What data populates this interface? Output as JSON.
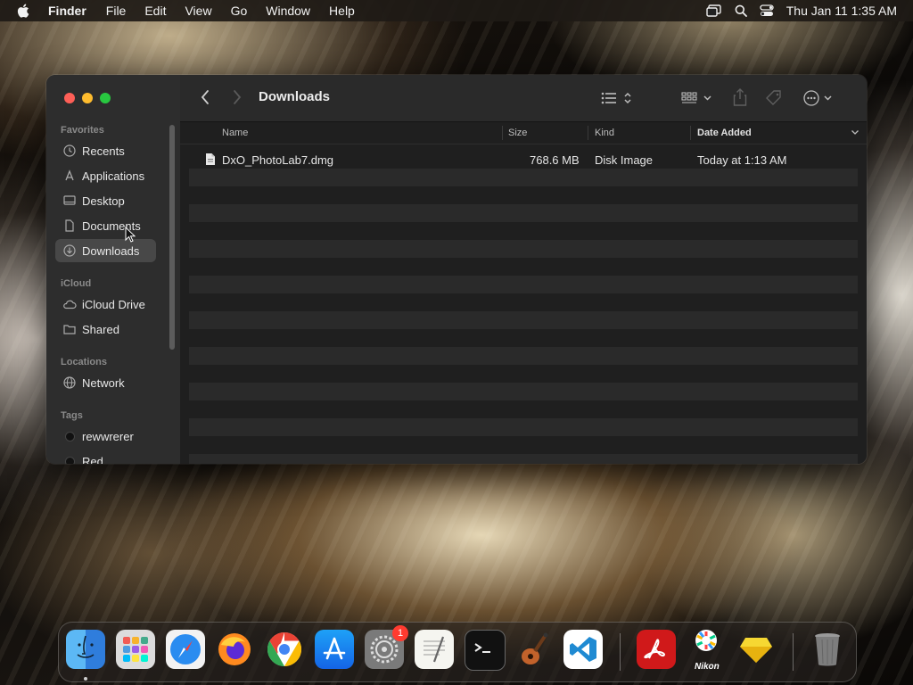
{
  "menubar": {
    "app_name": "Finder",
    "items": [
      "File",
      "Edit",
      "View",
      "Go",
      "Window",
      "Help"
    ],
    "clock": "Thu Jan 11  1:35 AM",
    "status_icons": [
      "screen-mirroring-icon",
      "spotlight-search-icon",
      "control-center-icon"
    ]
  },
  "window": {
    "title": "Downloads",
    "sidebar": {
      "favorites_header": "Favorites",
      "favorites": [
        {
          "label": "Recents",
          "icon": "clock-icon"
        },
        {
          "label": "Applications",
          "icon": "applications-icon"
        },
        {
          "label": "Desktop",
          "icon": "desktop-icon"
        },
        {
          "label": "Documents",
          "icon": "document-icon"
        },
        {
          "label": "Downloads",
          "icon": "download-icon",
          "selected": true
        }
      ],
      "icloud_header": "iCloud",
      "icloud": [
        {
          "label": "iCloud Drive",
          "icon": "cloud-icon"
        },
        {
          "label": "Shared",
          "icon": "shared-folder-icon"
        }
      ],
      "locations_header": "Locations",
      "locations": [
        {
          "label": "Network",
          "icon": "network-globe-icon"
        }
      ],
      "tags_header": "Tags",
      "tags": [
        {
          "label": "rewwrerer"
        },
        {
          "label": "Red"
        }
      ]
    },
    "columns": {
      "name": "Name",
      "size": "Size",
      "kind": "Kind",
      "date_added": "Date Added"
    },
    "files": [
      {
        "name": "DxO_PhotoLab7.dmg",
        "size": "768.6 MB",
        "kind": "Disk Image",
        "date_added": "Today at 1:13 AM"
      }
    ]
  },
  "dock": {
    "apps": [
      "Finder",
      "Launchpad",
      "Safari",
      "Firefox",
      "Chrome",
      "App Store",
      "System Settings",
      "TextEdit",
      "Terminal",
      "GarageBand",
      "Visual Studio Code",
      "Adobe Acrobat",
      "Nikon",
      "Sketch",
      "Trash"
    ],
    "system_settings_badge": "1",
    "nikon_label": "Nikon"
  },
  "colors": {
    "close": "#fe5f57",
    "minimize": "#febc2e",
    "maximize": "#28c840",
    "selection": "#484848"
  }
}
